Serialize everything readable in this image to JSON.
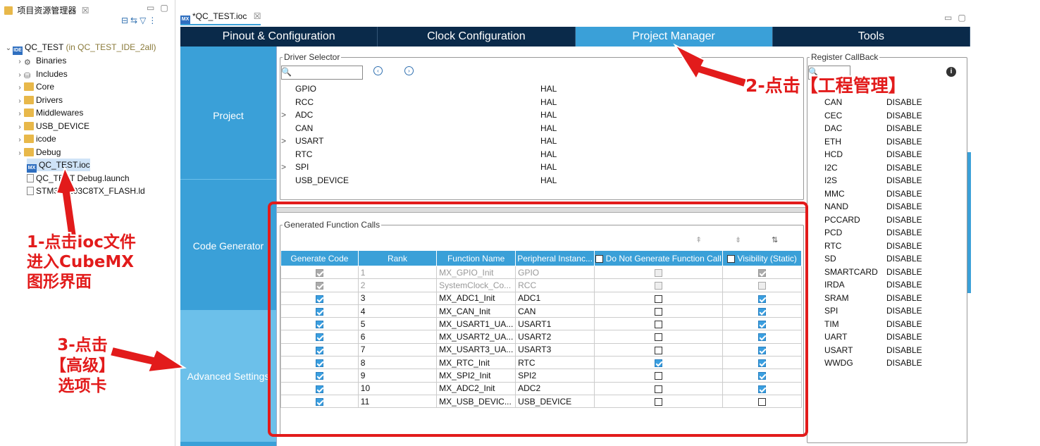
{
  "explorer": {
    "title": "项目资源管理器",
    "close": "☒",
    "project": {
      "name": "QC_TEST",
      "suffix": "(in QC_TEST_IDE_2all)"
    },
    "items": [
      {
        "label": "Binaries",
        "type": "bin"
      },
      {
        "label": "Includes",
        "type": "inc"
      },
      {
        "label": "Core",
        "type": "folder"
      },
      {
        "label": "Drivers",
        "type": "folder"
      },
      {
        "label": "Middlewares",
        "type": "folder"
      },
      {
        "label": "USB_DEVICE",
        "type": "folder"
      },
      {
        "label": "icode",
        "type": "folder"
      },
      {
        "label": "Debug",
        "type": "folder-open"
      }
    ],
    "files": [
      {
        "label": "QC_TEST.ioc",
        "selected": true
      },
      {
        "label": "QC_TEST Debug.launch",
        "selected": false
      },
      {
        "label": "STM32F103C8TX_FLASH.ld",
        "selected": false
      }
    ]
  },
  "editor": {
    "tab_label": "*QC_TEST.ioc",
    "close": "☒"
  },
  "tabs": [
    "Pinout & Configuration",
    "Clock Configuration",
    "Project Manager",
    "Tools"
  ],
  "leftnav": [
    "Project",
    "Code Generator",
    "Advanced Settings"
  ],
  "driver_selector": {
    "legend": "Driver Selector",
    "rows": [
      {
        "expand": "",
        "name": "GPIO",
        "driver": "HAL"
      },
      {
        "expand": "",
        "name": "RCC",
        "driver": "HAL"
      },
      {
        "expand": ">",
        "name": "ADC",
        "driver": "HAL"
      },
      {
        "expand": "",
        "name": "CAN",
        "driver": "HAL"
      },
      {
        "expand": ">",
        "name": "USART",
        "driver": "HAL"
      },
      {
        "expand": "",
        "name": "RTC",
        "driver": "HAL"
      },
      {
        "expand": ">",
        "name": "SPI",
        "driver": "HAL"
      },
      {
        "expand": "",
        "name": "USB_DEVICE",
        "driver": "HAL"
      }
    ]
  },
  "gen_calls": {
    "legend": "Generated Function Calls",
    "headers": [
      "Generate Code",
      "Rank",
      "Function Name",
      "Peripheral Instanc...",
      "Do Not Generate Function Call",
      "Visibility (Static)"
    ],
    "rows": [
      {
        "gen": true,
        "rank": "1",
        "func": "MX_GPIO_Init",
        "periph": "GPIO",
        "nogen": false,
        "vis": true,
        "dim": true
      },
      {
        "gen": true,
        "rank": "2",
        "func": "SystemClock_Co...",
        "periph": "RCC",
        "nogen": false,
        "vis": false,
        "dim": true
      },
      {
        "gen": true,
        "rank": "3",
        "func": "MX_ADC1_Init",
        "periph": "ADC1",
        "nogen": false,
        "vis": true,
        "dim": false
      },
      {
        "gen": true,
        "rank": "4",
        "func": "MX_CAN_Init",
        "periph": "CAN",
        "nogen": false,
        "vis": true,
        "dim": false
      },
      {
        "gen": true,
        "rank": "5",
        "func": "MX_USART1_UA...",
        "periph": "USART1",
        "nogen": false,
        "vis": true,
        "dim": false
      },
      {
        "gen": true,
        "rank": "6",
        "func": "MX_USART2_UA...",
        "periph": "USART2",
        "nogen": false,
        "vis": true,
        "dim": false
      },
      {
        "gen": true,
        "rank": "7",
        "func": "MX_USART3_UA...",
        "periph": "USART3",
        "nogen": false,
        "vis": true,
        "dim": false
      },
      {
        "gen": true,
        "rank": "8",
        "func": "MX_RTC_Init",
        "periph": "RTC",
        "nogen": true,
        "vis": true,
        "dim": false
      },
      {
        "gen": true,
        "rank": "9",
        "func": "MX_SPI2_Init",
        "periph": "SPI2",
        "nogen": false,
        "vis": true,
        "dim": false
      },
      {
        "gen": true,
        "rank": "10",
        "func": "MX_ADC2_Init",
        "periph": "ADC2",
        "nogen": false,
        "vis": true,
        "dim": false
      },
      {
        "gen": true,
        "rank": "11",
        "func": "MX_USB_DEVIC...",
        "periph": "USB_DEVICE",
        "nogen": false,
        "vis": false,
        "dim": false
      }
    ]
  },
  "register_callback": {
    "legend": "Register CallBack",
    "rows": [
      {
        "name": "CAN",
        "value": "DISABLE"
      },
      {
        "name": "CEC",
        "value": "DISABLE"
      },
      {
        "name": "DAC",
        "value": "DISABLE"
      },
      {
        "name": "ETH",
        "value": "DISABLE"
      },
      {
        "name": "HCD",
        "value": "DISABLE"
      },
      {
        "name": "I2C",
        "value": "DISABLE"
      },
      {
        "name": "I2S",
        "value": "DISABLE"
      },
      {
        "name": "MMC",
        "value": "DISABLE"
      },
      {
        "name": "NAND",
        "value": "DISABLE"
      },
      {
        "name": "PCCARD",
        "value": "DISABLE"
      },
      {
        "name": "PCD",
        "value": "DISABLE"
      },
      {
        "name": "RTC",
        "value": "DISABLE"
      },
      {
        "name": "SD",
        "value": "DISABLE"
      },
      {
        "name": "SMARTCARD",
        "value": "DISABLE"
      },
      {
        "name": "IRDA",
        "value": "DISABLE"
      },
      {
        "name": "SRAM",
        "value": "DISABLE"
      },
      {
        "name": "SPI",
        "value": "DISABLE"
      },
      {
        "name": "TIM",
        "value": "DISABLE"
      },
      {
        "name": "UART",
        "value": "DISABLE"
      },
      {
        "name": "USART",
        "value": "DISABLE"
      },
      {
        "name": "WWDG",
        "value": "DISABLE"
      }
    ]
  },
  "annotations": {
    "step1": [
      "1-点击ioc文件",
      "进入CubeMX",
      "图形界面"
    ],
    "step2": "2-点击【工程管理】",
    "step3": [
      "3-点击",
      "【高级】",
      "选项卡"
    ]
  },
  "colors": {
    "accent": "#3aa0d8",
    "dark_tab": "#0a2a4a",
    "annotation": "#e21b1b"
  }
}
